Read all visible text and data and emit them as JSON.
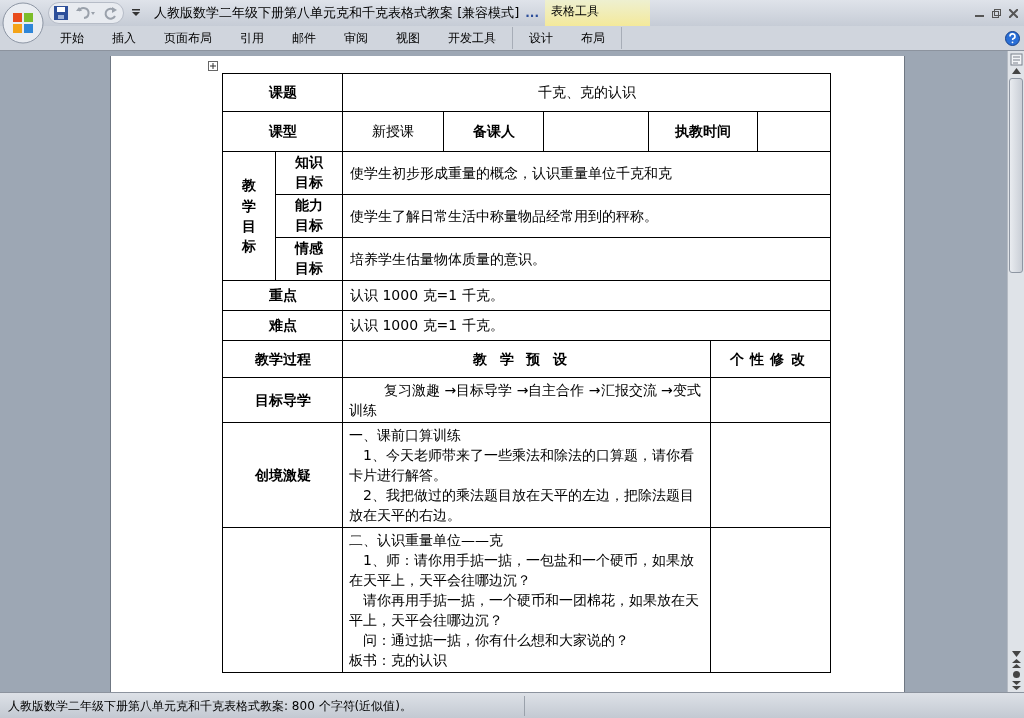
{
  "window": {
    "title": "人教版数学二年级下册第八单元克和千克表格式教案 [兼容模式]",
    "title_overflow": "..."
  },
  "contextual_group": "表格工具",
  "ribbon_tabs": [
    "开始",
    "插入",
    "页面布局",
    "引用",
    "邮件",
    "审阅",
    "视图",
    "开发工具"
  ],
  "contextual_tabs": [
    "设计",
    "布局"
  ],
  "table": {
    "topic": {
      "label": "课题",
      "value": "千克、克的认识"
    },
    "type": {
      "label": "课型",
      "value": "新授课",
      "preparer_label": "备课人",
      "date_label": "执教时间"
    },
    "objectives": {
      "label": "教学目标",
      "items": [
        {
          "label": "知识目标",
          "text": "使学生初步形成重量的概念，认识重量单位千克和克"
        },
        {
          "label": "能力目标",
          "text": "使学生了解日常生活中称量物品经常用到的秤称。"
        },
        {
          "label": "情感目标",
          "text": "培养学生估量物体质量的意识。"
        }
      ]
    },
    "key_point": {
      "label": "重点",
      "text": "认识 1000 克=1 千克。"
    },
    "difficulty": {
      "label": "难点",
      "text": "认识 1000 克=1 千克。"
    },
    "process_header": [
      "教学过程",
      "教学预设",
      "个性修改"
    ],
    "process_rows": [
      {
        "stage": "目标导学",
        "paragraphs": [
          {
            "kind": "indent2",
            "text": "复习激趣 →目标导学 →自主合作 →汇报交流 →变式训练"
          }
        ]
      },
      {
        "stage": "创境激疑",
        "paragraphs": [
          {
            "kind": "plain",
            "text": "一、课前口算训练"
          },
          {
            "kind": "indent1",
            "text": "1、今天老师带来了一些乘法和除法的口算题，请你看卡片进行解答。"
          },
          {
            "kind": "indent1",
            "text": "2、我把做过的乘法题目放在天平的左边，把除法题目放在天平的右边。"
          }
        ]
      },
      {
        "paragraphs": [
          {
            "kind": "plain",
            "text": "二、认识重量单位——克"
          },
          {
            "kind": "indent1",
            "text": "1、师：请你用手掂一掂，一包盐和一个硬币，如果放在天平上，天平会往哪边沉？"
          },
          {
            "kind": "indent1",
            "text": "请你再用手掂一掂，一个硬币和一团棉花，如果放在天平上，天平会往哪边沉？"
          },
          {
            "kind": "indent1",
            "text": "问：通过掂一掂，你有什么想和大家说的？"
          },
          {
            "kind": "plain",
            "text": "板书：克的认识"
          }
        ]
      }
    ]
  },
  "status_bar": "人教版数学二年级下册第八单元克和千克表格式教案: 800 个字符(近似值)。"
}
